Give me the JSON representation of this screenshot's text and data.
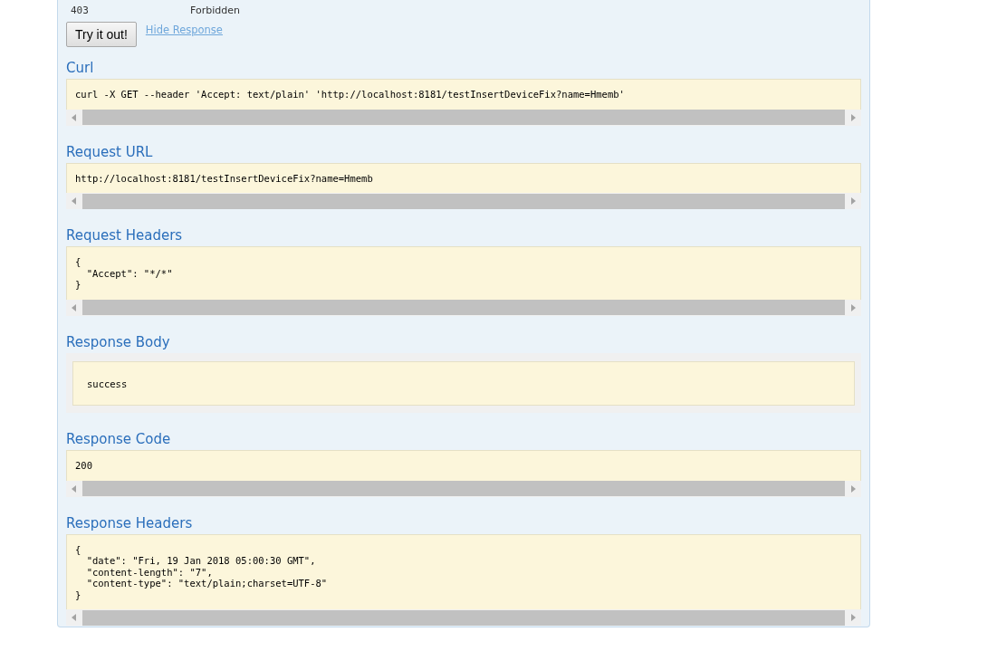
{
  "status_row": {
    "code": "403",
    "message": "Forbidden"
  },
  "try_button": "Try it out!",
  "hide_link": "Hide Response",
  "sections": [
    {
      "kind": "code",
      "title": "Curl",
      "lines": [
        "curl -X GET --header 'Accept: text/plain' 'http://localhost:8181/testInsertDeviceFix?name=Hmemb'"
      ]
    },
    {
      "kind": "code",
      "title": "Request URL",
      "lines": [
        "http://localhost:8181/testInsertDeviceFix?name=Hmemb"
      ]
    },
    {
      "kind": "code",
      "title": "Request Headers",
      "lines": [
        "{",
        "  \"Accept\": \"*/*\"",
        "}"
      ]
    },
    {
      "kind": "body",
      "title": "Response Body",
      "lines": [
        "success"
      ]
    },
    {
      "kind": "code",
      "title": "Response Code",
      "lines": [
        "200"
      ]
    },
    {
      "kind": "code",
      "title": "Response Headers",
      "lines": [
        "{",
        "  \"date\": \"Fri, 19 Jan 2018 05:00:30 GMT\",",
        "  \"content-length\": \"7\",",
        "  \"content-type\": \"text/plain;charset=UTF-8\"",
        "}"
      ]
    }
  ]
}
